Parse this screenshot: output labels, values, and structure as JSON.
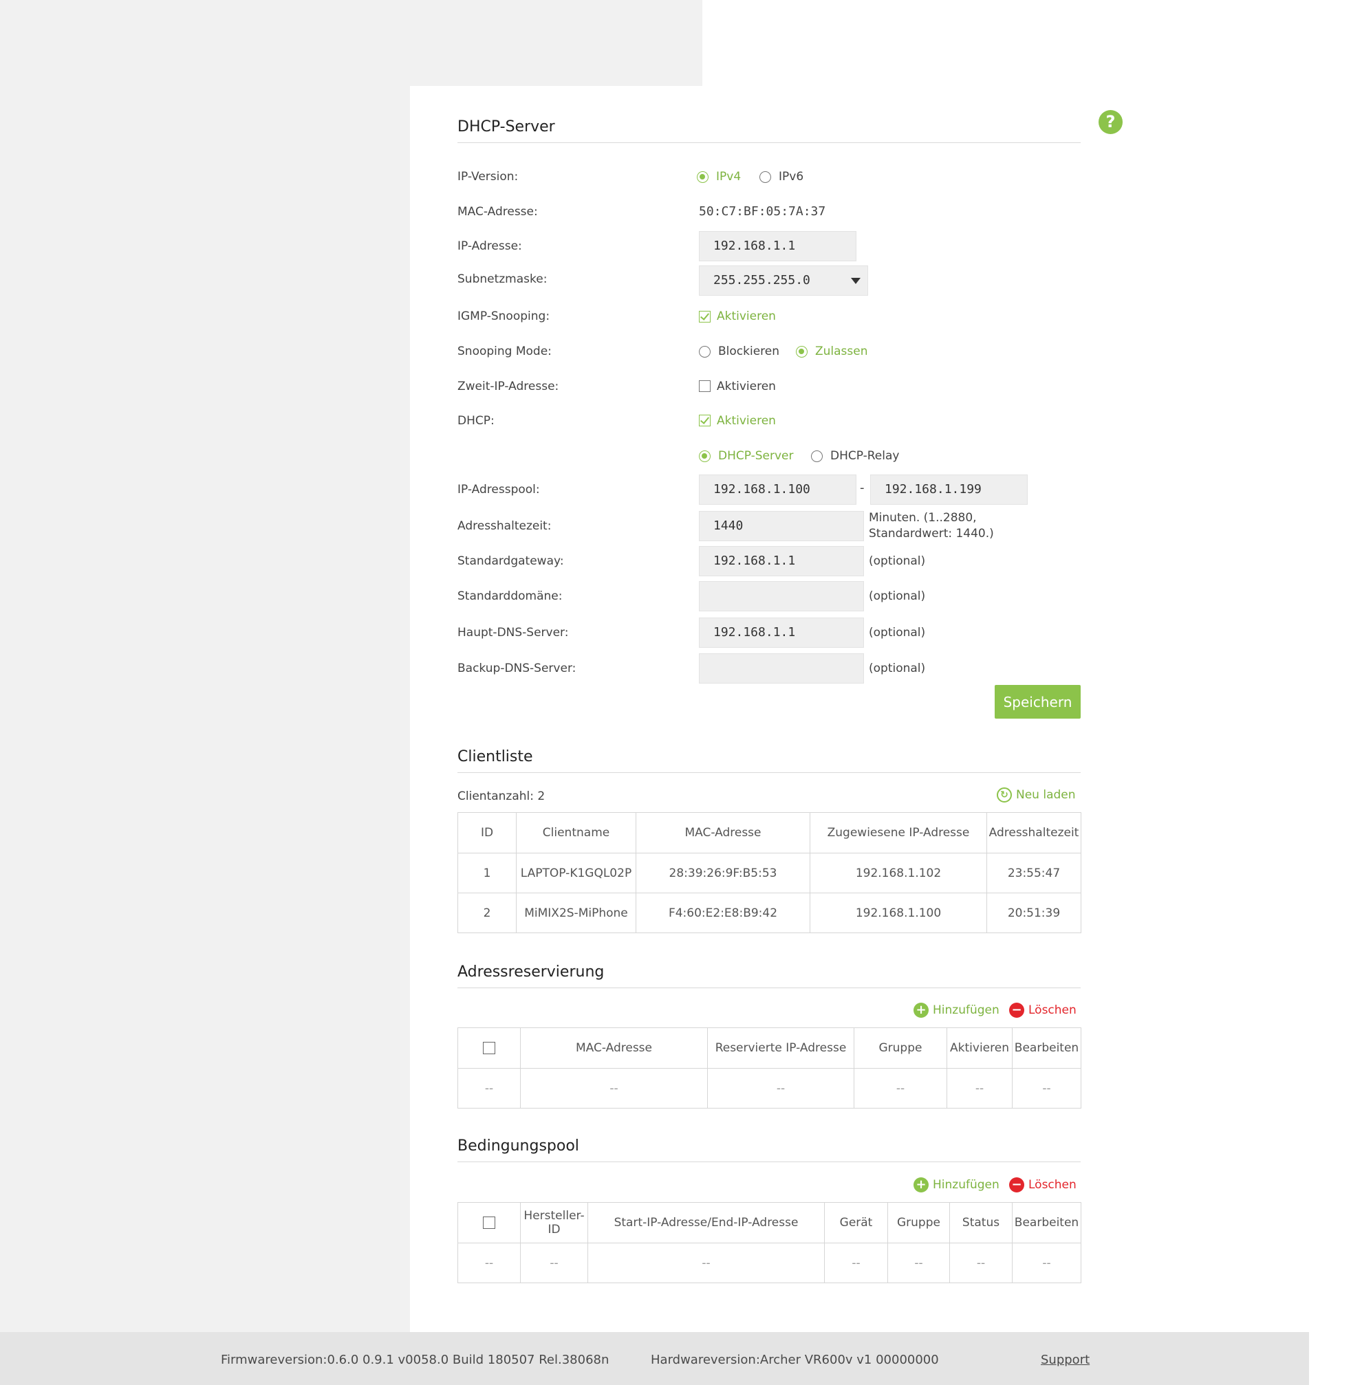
{
  "help": {
    "label": "?"
  },
  "dhcp": {
    "title": "DHCP-Server",
    "ip_version": {
      "label": "IP-Version:",
      "options": [
        "IPv4",
        "IPv6"
      ],
      "selected": "IPv4"
    },
    "mac": {
      "label": "MAC-Adresse:",
      "value": "50:C7:BF:05:7A:37"
    },
    "ip": {
      "label": "IP-Adresse:",
      "value": "192.168.1.1"
    },
    "subnet": {
      "label": "Subnetzmaske:",
      "value": "255.255.255.0"
    },
    "igmp": {
      "label": "IGMP-Snooping:",
      "option": "Aktivieren",
      "checked": true
    },
    "snooping_mode": {
      "label": "Snooping Mode:",
      "options": [
        "Blockieren",
        "Zulassen"
      ],
      "selected": "Zulassen"
    },
    "second_ip": {
      "label": "Zweit-IP-Adresse:",
      "option": "Aktivieren",
      "checked": false
    },
    "dhcp": {
      "label": "DHCP:",
      "option": "Aktivieren",
      "checked": true
    },
    "dhcp_mode": {
      "options": [
        "DHCP-Server",
        "DHCP-Relay"
      ],
      "selected": "DHCP-Server"
    },
    "pool": {
      "label": "IP-Adresspool:",
      "start": "192.168.1.100",
      "separator": "-",
      "end": "192.168.1.199"
    },
    "lease": {
      "label": "Adresshaltezeit:",
      "value": "1440",
      "hint_line1": "Minuten. (1..2880,",
      "hint_line2": "Standardwert: 1440.)"
    },
    "gateway": {
      "label": "Standardgateway:",
      "value": "192.168.1.1",
      "hint": "(optional)"
    },
    "domain": {
      "label": "Standarddomäne:",
      "value": "",
      "hint": "(optional)"
    },
    "dns1": {
      "label": "Haupt-DNS-Server:",
      "value": "192.168.1.1",
      "hint": "(optional)"
    },
    "dns2": {
      "label": "Backup-DNS-Server:",
      "value": "",
      "hint": "(optional)"
    },
    "save": "Speichern"
  },
  "clients": {
    "title": "Clientliste",
    "count_label": "Clientanzahl: 2",
    "reload": "Neu laden",
    "columns": [
      "ID",
      "Clientname",
      "MAC-Adresse",
      "Zugewiesene IP-Adresse",
      "Adresshaltezeit"
    ],
    "rows": [
      [
        "1",
        "LAPTOP-K1GQL02P",
        "28:39:26:9F:B5:53",
        "192.168.1.102",
        "23:55:47"
      ],
      [
        "2",
        "MiMIX2S-MiPhone",
        "F4:60:E2:E8:B9:42",
        "192.168.1.100",
        "20:51:39"
      ]
    ]
  },
  "reservation": {
    "title": "Adressreservierung",
    "add": "Hinzufügen",
    "delete": "Löschen",
    "columns": [
      "MAC-Adresse",
      "Reservierte IP-Adresse",
      "Gruppe",
      "Aktivieren",
      "Bearbeiten"
    ],
    "empty": "--"
  },
  "condition": {
    "title": "Bedingungspool",
    "add": "Hinzufügen",
    "delete": "Löschen",
    "columns": [
      "Hersteller-ID",
      "Start-IP-Adresse/End-IP-Adresse",
      "Gerät",
      "Gruppe",
      "Status",
      "Bearbeiten"
    ],
    "empty": "--"
  },
  "footer": {
    "firmware": "Firmwareversion:0.6.0 0.9.1 v0058.0 Build 180507 Rel.38068n",
    "hardware": "Hardwareversion:Archer VR600v v1 00000000",
    "support": "Support"
  }
}
